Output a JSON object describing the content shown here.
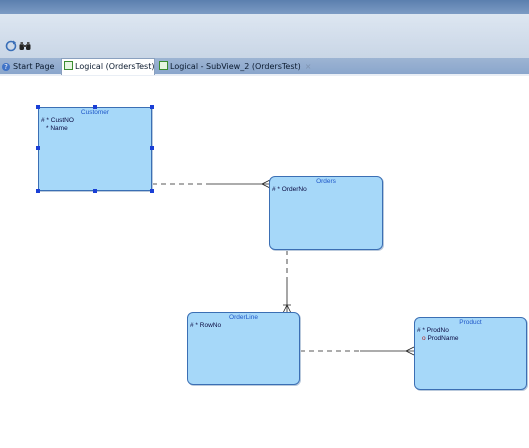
{
  "toolbar": {
    "buttons": [
      {
        "name": "refresh-icon"
      },
      {
        "name": "binoculars-icon"
      }
    ]
  },
  "tabs": [
    {
      "label": "Start Page",
      "active": false
    },
    {
      "label": "Logical (OrdersTest)",
      "active": true
    },
    {
      "label": "Logical - SubView_2 (OrdersTest)",
      "active": false
    }
  ],
  "entities": {
    "customer": {
      "title": "Customer",
      "attributes": [
        {
          "marker": "# *",
          "name": "CustNO"
        },
        {
          "marker": "*",
          "name": "Name"
        }
      ]
    },
    "orders": {
      "title": "Orders",
      "attributes": [
        {
          "marker": "# *",
          "name": "OrderNo"
        }
      ]
    },
    "orderline": {
      "title": "OrderLine",
      "attributes": [
        {
          "marker": "# *",
          "name": "RowNo"
        }
      ]
    },
    "product": {
      "title": "Product",
      "attributes": [
        {
          "marker": "# *",
          "name": "ProdNo"
        },
        {
          "marker": "o",
          "name": "ProdName"
        }
      ]
    }
  },
  "colors": {
    "entity_fill": "#a6d8f9",
    "entity_border": "#3b6fb4",
    "entity_title": "#1f57c8",
    "selection_handle": "#1a3fd6"
  }
}
